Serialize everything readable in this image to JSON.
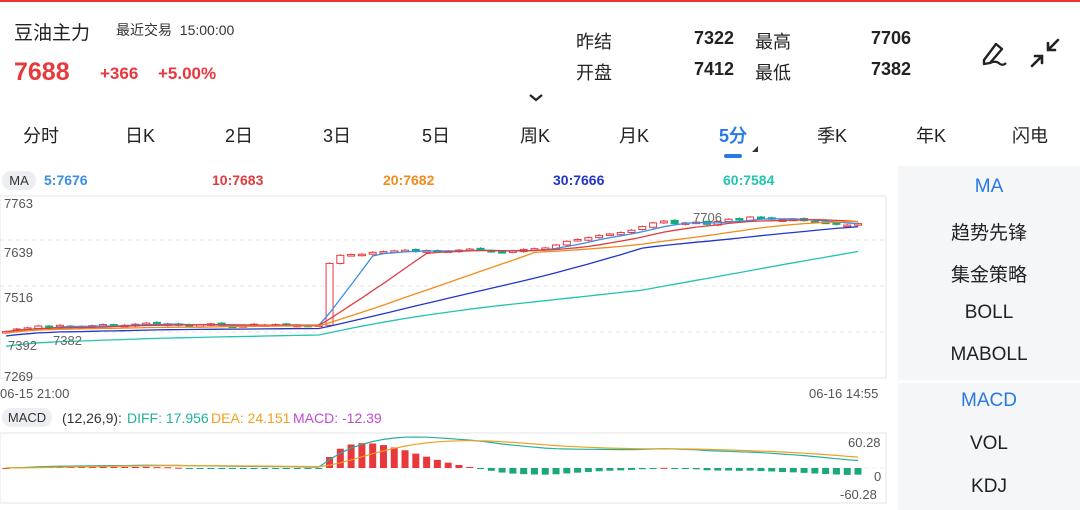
{
  "header": {
    "name": "豆油主力",
    "recent_label": "最近交易",
    "time": "15:00:00",
    "price": "7688",
    "change": "+366",
    "change_pct": "+5.00%",
    "stats": [
      {
        "label": "昨结",
        "value": "7322"
      },
      {
        "label": "最高",
        "value": "7706"
      },
      {
        "label": "开盘",
        "value": "7412"
      },
      {
        "label": "最低",
        "value": "7382"
      }
    ],
    "edit_icon": "pen-icon",
    "collapse_icon": "collapse-arrows-icon",
    "expand_icon": "chevron-down-icon"
  },
  "tabs": [
    "分时",
    "日K",
    "2日",
    "3日",
    "5日",
    "周K",
    "月K",
    "5分",
    "季K",
    "年K",
    "闪电"
  ],
  "active_tab": "5分",
  "ma_bar": {
    "tag": "MA",
    "ma5": "5:7676",
    "ma10": "10:7683",
    "ma20": "20:7682",
    "ma30": "30:7666",
    "ma60": "60:7584"
  },
  "axis": {
    "y_top": "7763",
    "y_2": "7639",
    "y_3": "7516",
    "y_bottom": "7269",
    "start_time": "06-15 21:00",
    "end_time": "06-16 14:55",
    "high_mark": "7706",
    "low_mark_1": "7392",
    "low_mark_2": "7382"
  },
  "macd_bar": {
    "tag": "MACD",
    "params": "(12,26,9):",
    "diff": "DIFF: 17.956",
    "dea": "DEA: 24.151",
    "macd": "MACD: -12.39",
    "axis_top": "60.28",
    "axis_zero": "0",
    "axis_bottom": "-60.28"
  },
  "side_menu": {
    "main": [
      "MA",
      "趋势先锋",
      "集金策略",
      "BOLL",
      "MABOLL"
    ],
    "sub": [
      "MACD",
      "VOL",
      "KDJ"
    ]
  },
  "colors": {
    "up": "#e8383d",
    "down": "#19a87a",
    "accent": "#2878e6",
    "ma5": "#3a8ee6",
    "ma10": "#e03c3c",
    "ma20": "#f08c1c",
    "ma30": "#2236c8",
    "ma60": "#23c4b0"
  },
  "chart_data": {
    "type": "candlestick",
    "title": "",
    "xlabel": "",
    "ylabel": "",
    "ylim": [
      7269,
      7763
    ],
    "x_range": [
      "06-15 21:00",
      "06-16 14:55"
    ],
    "close_approx": [
      7395,
      7402,
      7405,
      7410,
      7408,
      7412,
      7406,
      7409,
      7411,
      7414,
      7410,
      7412,
      7415,
      7418,
      7414,
      7416,
      7412,
      7410,
      7413,
      7416,
      7412,
      7409,
      7411,
      7415,
      7413,
      7414,
      7411,
      7412,
      7410,
      7413,
      7580,
      7602,
      7604,
      7605,
      7610,
      7612,
      7614,
      7616,
      7612,
      7615,
      7612,
      7614,
      7616,
      7619,
      7617,
      7612,
      7610,
      7614,
      7618,
      7620,
      7622,
      7630,
      7640,
      7645,
      7650,
      7656,
      7660,
      7664,
      7670,
      7680,
      7690,
      7695,
      7688,
      7690,
      7692,
      7686,
      7694,
      7700,
      7698,
      7706,
      7702,
      7700,
      7698,
      7700,
      7696,
      7692,
      7690,
      7686,
      7684,
      7688
    ]
  }
}
